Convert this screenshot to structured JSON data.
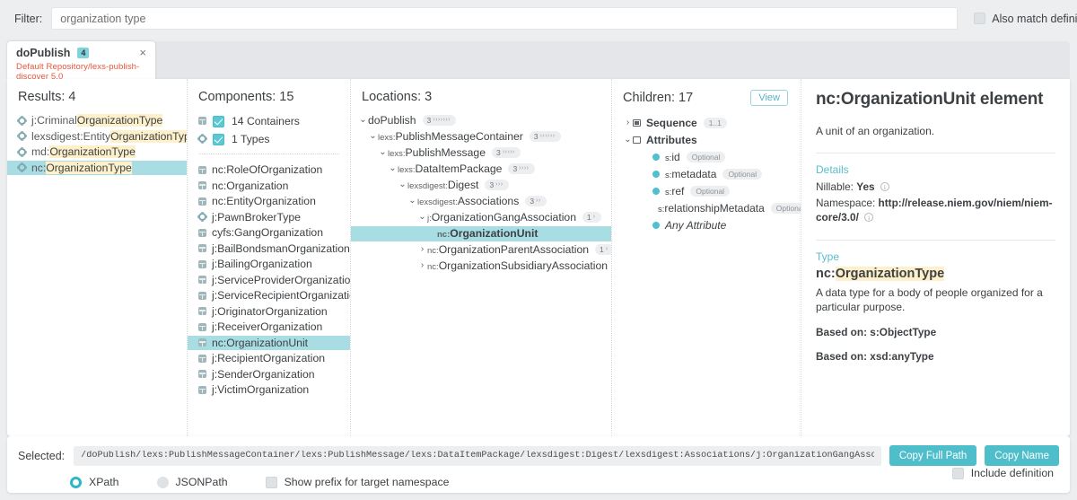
{
  "filter": {
    "label": "Filter:",
    "value": "organization type",
    "placeholder": "",
    "also_match_definitions": "Also match definitions"
  },
  "tab": {
    "title": "doPublish",
    "badge": "4",
    "subtitle": "Default Repository/lexs-publish-discover 5.0",
    "close": "×"
  },
  "results": {
    "header": "Results: 4",
    "items": [
      {
        "prefix": "j:Criminal",
        "match": "OrganizationType",
        "suffix": "",
        "icon": "gear-icon",
        "selected": false
      },
      {
        "prefix": "lexsdigest:Entity",
        "match": "OrganizationType",
        "suffix": "",
        "icon": "gear-icon",
        "selected": false
      },
      {
        "prefix": "md:",
        "match": "OrganizationType",
        "suffix": "",
        "icon": "gear-icon",
        "selected": false
      },
      {
        "prefix": "nc:",
        "match": "OrganizationType",
        "suffix": "",
        "icon": "gear-icon",
        "selected": true
      }
    ]
  },
  "components": {
    "header": "Components: 15",
    "filters": [
      {
        "label": "14 Containers",
        "icon": "cube-icon",
        "checked": true
      },
      {
        "label": "1 Types",
        "icon": "gear-icon",
        "checked": true
      }
    ],
    "items": [
      {
        "label": "nc:RoleOfOrganization",
        "icon": "cube-icon",
        "selected": false
      },
      {
        "label": "nc:Organization",
        "icon": "cube-icon",
        "selected": false
      },
      {
        "label": "nc:EntityOrganization",
        "icon": "cube-icon",
        "selected": false
      },
      {
        "label": "j:PawnBrokerType",
        "icon": "gear-icon",
        "selected": false
      },
      {
        "label": "cyfs:GangOrganization",
        "icon": "cube-icon",
        "selected": false
      },
      {
        "label": "j:BailBondsmanOrganization",
        "icon": "cube-icon",
        "selected": false
      },
      {
        "label": "j:BailingOrganization",
        "icon": "cube-icon",
        "selected": false
      },
      {
        "label": "j:ServiceProviderOrganization",
        "icon": "cube-icon",
        "selected": false
      },
      {
        "label": "j:ServiceRecipientOrganization",
        "icon": "cube-icon",
        "selected": false
      },
      {
        "label": "j:OriginatorOrganization",
        "icon": "cube-icon",
        "selected": false
      },
      {
        "label": "j:ReceiverOrganization",
        "icon": "cube-icon",
        "selected": false
      },
      {
        "label": "nc:OrganizationUnit",
        "icon": "cube-icon",
        "selected": true
      },
      {
        "label": "j:RecipientOrganization",
        "icon": "cube-icon",
        "selected": false
      },
      {
        "label": "j:SenderOrganization",
        "icon": "cube-icon",
        "selected": false
      },
      {
        "label": "j:VictimOrganization",
        "icon": "cube-icon",
        "selected": false
      }
    ]
  },
  "locations": {
    "header": "Locations: 3",
    "nodes": [
      {
        "depth": 0,
        "chevron": "⌄",
        "prefix": "",
        "name": "doPublish",
        "count": "3",
        "dots": "›››››››",
        "selected": false
      },
      {
        "depth": 1,
        "chevron": "⌄",
        "prefix": "lexs:",
        "name": "PublishMessageContainer",
        "count": "3",
        "dots": "››››››",
        "selected": false
      },
      {
        "depth": 2,
        "chevron": "⌄",
        "prefix": "lexs:",
        "name": "PublishMessage",
        "count": "3",
        "dots": "›››››",
        "selected": false
      },
      {
        "depth": 3,
        "chevron": "⌄",
        "prefix": "lexs:",
        "name": "DataItemPackage",
        "count": "3",
        "dots": "››››",
        "selected": false
      },
      {
        "depth": 4,
        "chevron": "⌄",
        "prefix": "lexsdigest:",
        "name": "Digest",
        "count": "3",
        "dots": "›››",
        "selected": false
      },
      {
        "depth": 5,
        "chevron": "⌄",
        "prefix": "lexsdigest:",
        "name": "Associations",
        "count": "3",
        "dots": "››",
        "selected": false
      },
      {
        "depth": 6,
        "chevron": "⌄",
        "prefix": "j:",
        "name": "OrganizationGangAssociation",
        "count": "1",
        "dots": "›",
        "selected": false
      },
      {
        "depth": 7,
        "chevron": "",
        "prefix": "nc:",
        "name": "OrganizationUnit",
        "count": "",
        "dots": "",
        "selected": true
      },
      {
        "depth": 6,
        "chevron": "›",
        "prefix": "nc:",
        "name": "OrganizationParentAssociation",
        "count": "1",
        "dots": "›",
        "selected": false
      },
      {
        "depth": 6,
        "chevron": "›",
        "prefix": "nc:",
        "name": "OrganizationSubsidiaryAssociation",
        "count": "1",
        "dots": "›",
        "selected": false
      }
    ]
  },
  "children": {
    "header": "Children: 17",
    "view_button": "View",
    "nodes": [
      {
        "depth": 0,
        "chevron": "›",
        "icon": "sequence-icon",
        "prefix": "",
        "name": "Sequence",
        "badge": "1..1",
        "bold": true,
        "italic": false
      },
      {
        "depth": 0,
        "chevron": "⌄",
        "icon": "attributes-icon",
        "prefix": "",
        "name": "Attributes",
        "badge": "",
        "bold": true,
        "italic": false
      },
      {
        "depth": 1,
        "chevron": "",
        "icon": "attribute-dot-icon",
        "prefix": "s:",
        "name": "id",
        "badge": "Optional",
        "bold": false,
        "italic": false
      },
      {
        "depth": 1,
        "chevron": "",
        "icon": "attribute-dot-icon",
        "prefix": "s:",
        "name": "metadata",
        "badge": "Optional",
        "bold": false,
        "italic": false
      },
      {
        "depth": 1,
        "chevron": "",
        "icon": "attribute-dot-icon",
        "prefix": "s:",
        "name": "ref",
        "badge": "Optional",
        "bold": false,
        "italic": false
      },
      {
        "depth": 1,
        "chevron": "",
        "icon": "attribute-dot-icon",
        "prefix": "s:",
        "name": "relationshipMetadata",
        "badge": "Optional",
        "bold": false,
        "italic": false
      },
      {
        "depth": 1,
        "chevron": "",
        "icon": "attribute-dot-icon",
        "prefix": "",
        "name": "Any Attribute",
        "badge": "",
        "bold": false,
        "italic": true
      }
    ]
  },
  "details": {
    "title": "nc:OrganizationUnit element",
    "description": "A unit of an organization.",
    "details_heading": "Details",
    "nillable_label": "Nillable:",
    "nillable_value": "Yes",
    "namespace_label": "Namespace:",
    "namespace_value": "http://release.niem.gov/niem/niem-core/3.0/",
    "type_heading": "Type",
    "type_prefix": "nc:",
    "type_match": "OrganizationType",
    "type_description": "A data type for a body of people organized for a particular purpose.",
    "based_on_1": "Based on: s:ObjectType",
    "based_on_2": "Based on: xsd:anyType"
  },
  "bottom": {
    "selected_label": "Selected:",
    "path": "/doPublish/lexs:PublishMessageContainer/lexs:PublishMessage/lexs:DataItemPackage/lexsdigest:Digest/lexsdigest:Associations/j:OrganizationGangAssociation/nc:OrganizationUnit",
    "copy_full_path": "Copy Full Path",
    "copy_name": "Copy Name",
    "xpath": "XPath",
    "jsonpath": "JSONPath",
    "show_prefix": "Show prefix for target namespace",
    "include_definition": "Include definition",
    "selected_format": "XPath"
  },
  "colors": {
    "accent": "#4fbecb",
    "selection": "#a8dde4",
    "highlight": "#fdf0ca",
    "tab_subtitle": "#e8563c"
  }
}
